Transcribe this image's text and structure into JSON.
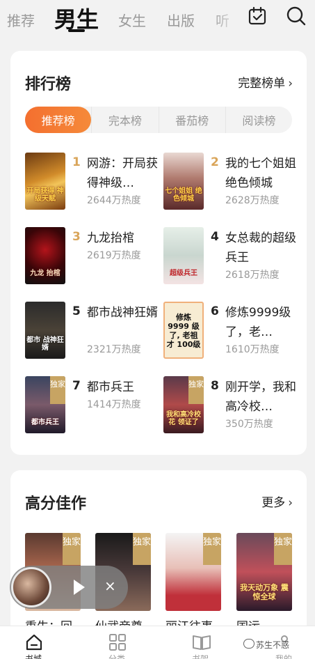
{
  "top_nav": {
    "tabs": [
      "推荐",
      "男生",
      "女生",
      "出版",
      "听"
    ],
    "active_tab": "男生",
    "icons": [
      "calendar-check-icon",
      "search-icon"
    ]
  },
  "ranking": {
    "title": "排行榜",
    "more_label": "完整榜单",
    "subtabs": [
      "推荐榜",
      "完本榜",
      "番茄榜",
      "阅读榜"
    ],
    "active_subtab": "推荐榜",
    "books": [
      {
        "rank": "1",
        "title": "网游：开局获得神级…",
        "heat": "2644万热度",
        "cover_text": "开局获得 神级天赋"
      },
      {
        "rank": "2",
        "title": "我的七个姐姐绝色倾城",
        "heat": "2628万热度",
        "cover_text": "七个姐姐 绝色倾城"
      },
      {
        "rank": "3",
        "title": "九龙抬棺",
        "heat": "2619万热度",
        "cover_text": "九龙 抬棺"
      },
      {
        "rank": "4",
        "title": "女总裁的超级兵王",
        "heat": "2618万热度",
        "cover_text": "超级兵王"
      },
      {
        "rank": "5",
        "title": "都市战神狂婿",
        "heat": "2321万热度",
        "cover_text": "都市 战神狂婿"
      },
      {
        "rank": "6",
        "title": "修炼9999级了，老…",
        "heat": "1610万热度",
        "cover_text": "修炼 9999 级了, 老祖才 100级"
      },
      {
        "rank": "7",
        "title": "都市兵王",
        "heat": "1414万热度",
        "cover_text": "都市兵王",
        "exclusive": "独家"
      },
      {
        "rank": "8",
        "title": "刚开学，我和高冷校…",
        "heat": "350万热度",
        "cover_text": "我和高冷校花 领证了",
        "exclusive": "独家"
      }
    ],
    "rank_colors": {
      "top": "#d9a55a",
      "normal": "#222222"
    }
  },
  "high_score": {
    "title": "高分佳作",
    "more_label": "更多",
    "books": [
      {
        "title": "重生：回",
        "exclusive": "独家"
      },
      {
        "title": "仙武帝尊",
        "exclusive": "独家"
      },
      {
        "title": "丽江往事",
        "exclusive": "独家"
      },
      {
        "title": "国运…",
        "exclusive": "独家",
        "cover_text": "我天动万象 震惊全球"
      }
    ]
  },
  "player": {
    "play_icon": "play-icon",
    "close_label": "×"
  },
  "bottom_nav": {
    "items": [
      "书城",
      "分类",
      "书架",
      "我的"
    ],
    "active": "书城",
    "watermark": "苏生不惑"
  },
  "colors": {
    "accent": "#f46f2f",
    "exclusive_badge": "#c7a463"
  }
}
